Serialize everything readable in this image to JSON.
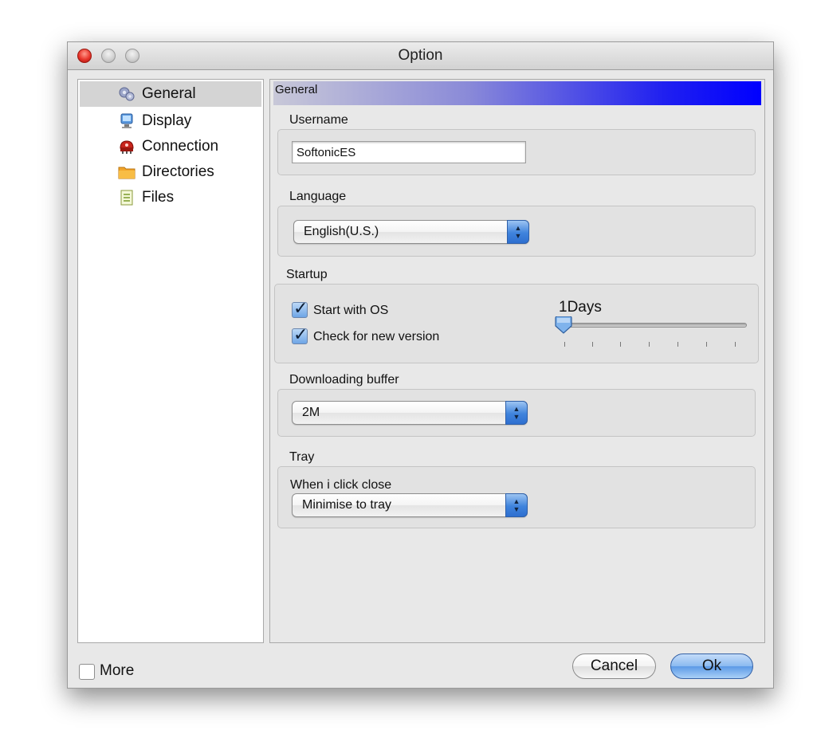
{
  "window": {
    "title": "Option"
  },
  "sidebar": {
    "items": [
      {
        "label": "General",
        "icon": "gears-icon",
        "selected": true
      },
      {
        "label": "Display",
        "icon": "monitor-icon",
        "selected": false
      },
      {
        "label": "Connection",
        "icon": "network-icon",
        "selected": false
      },
      {
        "label": "Directories",
        "icon": "folder-icon",
        "selected": false
      },
      {
        "label": "Files",
        "icon": "document-icon",
        "selected": false
      }
    ]
  },
  "panel": {
    "header": "General",
    "username": {
      "label": "Username",
      "value": "SoftonicES"
    },
    "language": {
      "label": "Language",
      "value": "English(U.S.)"
    },
    "startup": {
      "label": "Startup",
      "start_with_os": {
        "label": "Start with OS",
        "checked": true
      },
      "check_new_version": {
        "label": "Check for new version",
        "checked": true
      },
      "slider_value_label": "1Days",
      "slider_position_fraction": 0.0
    },
    "buffer": {
      "label": "Downloading buffer",
      "value": "2M"
    },
    "tray": {
      "label": "Tray",
      "sublabel": "When i click close",
      "value": "Minimise to tray"
    }
  },
  "footer": {
    "more_label": "More",
    "more_checked": false,
    "cancel_label": "Cancel",
    "ok_label": "Ok"
  },
  "colors": {
    "header_gradient_end": "#0000ff",
    "ok_button": "#5c9ae6",
    "close_light": "#e8352b"
  }
}
